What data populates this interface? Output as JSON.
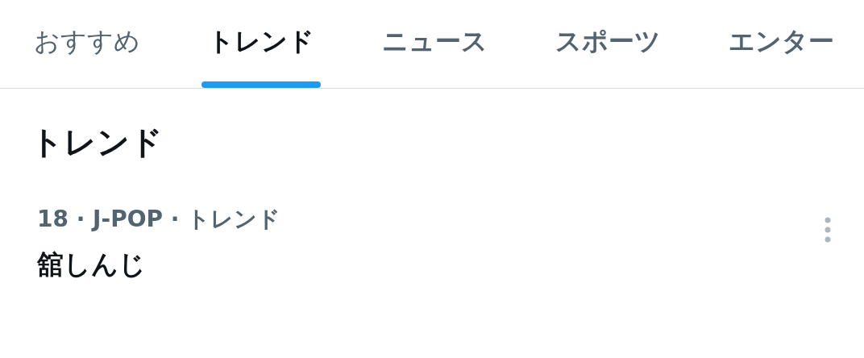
{
  "tabs": [
    {
      "label": "おすすめ",
      "selected": false
    },
    {
      "label": "トレンド",
      "selected": true
    },
    {
      "label": "ニュース",
      "selected": false
    },
    {
      "label": "スポーツ",
      "selected": false
    },
    {
      "label": "エンター",
      "selected": false
    }
  ],
  "section_title": "トレンド",
  "trends": [
    {
      "meta": "18 · J-POP · トレンド",
      "name": "舘しんじ"
    }
  ]
}
